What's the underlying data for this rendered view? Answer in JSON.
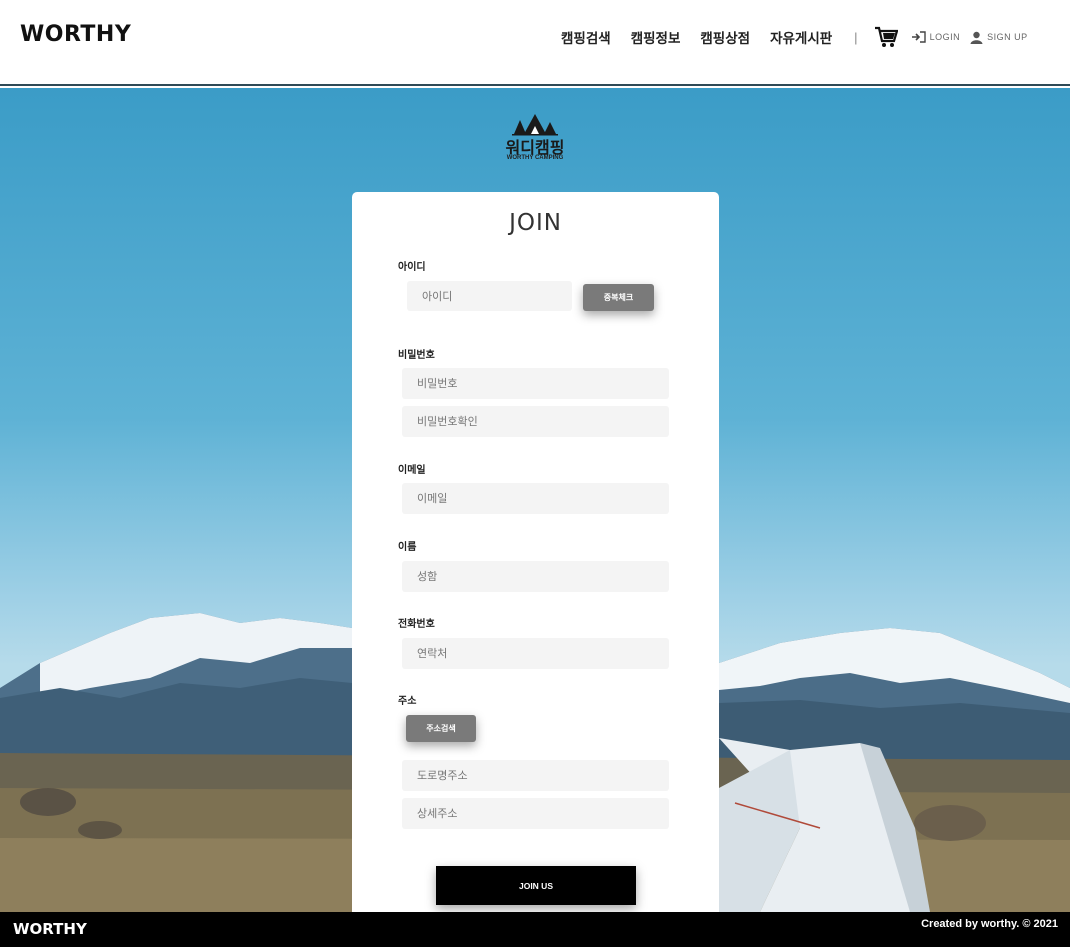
{
  "header": {
    "brand": "WORTHY",
    "nav": [
      "캠핑검색",
      "캠핑정보",
      "캠핑상점",
      "자유게시판"
    ],
    "divider": "|",
    "login_label": "LOGIN",
    "signup_label": "SIGN UP",
    "icons": {
      "cart": "cart-icon",
      "login": "login-icon",
      "signup": "user-icon"
    }
  },
  "logo": {
    "title": "워디캠핑",
    "subtitle": "WORTHY CAMPING"
  },
  "form": {
    "title": "JOIN",
    "id_label": "아이디",
    "id_placeholder": "아이디",
    "dup_check_button": "중복체크",
    "password_label": "비밀번호",
    "password_placeholder": "비밀번호",
    "password_confirm_placeholder": "비밀번호확인",
    "email_label": "이메일",
    "email_placeholder": "이메일",
    "name_label": "이름",
    "name_placeholder": "성함",
    "phone_label": "전화번호",
    "phone_placeholder": "연락처",
    "address_label": "주소",
    "address_search_button": "주소검색",
    "road_address_placeholder": "도로명주소",
    "detail_address_placeholder": "상세주소",
    "submit_button": "JOIN US"
  },
  "footer": {
    "brand": "WORTHY",
    "credit": "Created by worthy. © 2021"
  },
  "colors": {
    "sky": "#3b9cc7",
    "button_gray": "#7a7a7a",
    "footer_bg": "#000000",
    "field_bg": "#f4f4f4"
  }
}
